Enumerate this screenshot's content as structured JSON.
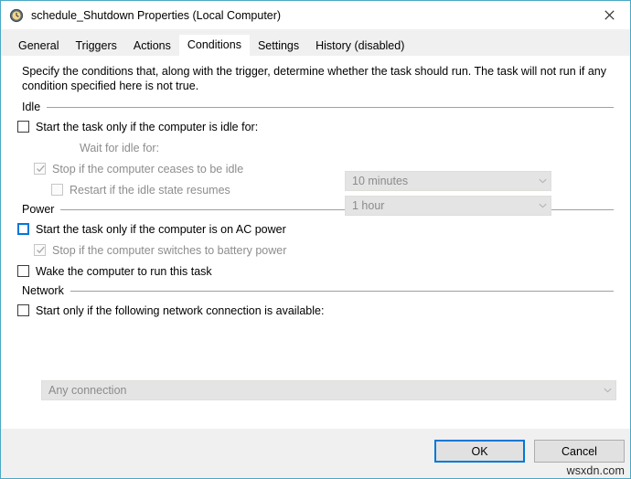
{
  "window": {
    "title": "schedule_Shutdown Properties (Local Computer)",
    "icon": "clock-icon",
    "close_label": "✕",
    "accent_color": "#4aa8c4",
    "focus_color": "#0078d7"
  },
  "tabs": [
    {
      "label": "General",
      "active": false
    },
    {
      "label": "Triggers",
      "active": false
    },
    {
      "label": "Actions",
      "active": false
    },
    {
      "label": "Conditions",
      "active": true
    },
    {
      "label": "Settings",
      "active": false
    },
    {
      "label": "History (disabled)",
      "active": false
    }
  ],
  "content": {
    "intro": "Specify the conditions that, along with the trigger, determine whether the task should run.  The task will not run  if any condition specified here is not true.",
    "groups": {
      "idle": {
        "label": "Idle",
        "start_idle_label": "Start the task only if the computer is idle for:",
        "start_idle_checked": false,
        "wait_label": "Wait for idle for:",
        "stop_idle_label": "Stop if the computer ceases to be idle",
        "stop_idle_checked": true,
        "restart_idle_label": "Restart if the idle state resumes",
        "restart_idle_checked": false,
        "idle_duration_value": "10 minutes",
        "wait_duration_value": "1 hour"
      },
      "power": {
        "label": "Power",
        "ac_power_label": "Start the task only if the computer is on AC power",
        "ac_power_checked": false,
        "battery_label": "Stop if the computer switches to battery power",
        "battery_checked": true,
        "wake_label": "Wake the computer to run this task",
        "wake_checked": false
      },
      "network": {
        "label": "Network",
        "network_label": "Start only if the following network connection is available:",
        "network_checked": false,
        "connection_value": "Any connection"
      }
    }
  },
  "footer": {
    "ok_label": "OK",
    "cancel_label": "Cancel"
  },
  "watermark": "wsxdn.com"
}
